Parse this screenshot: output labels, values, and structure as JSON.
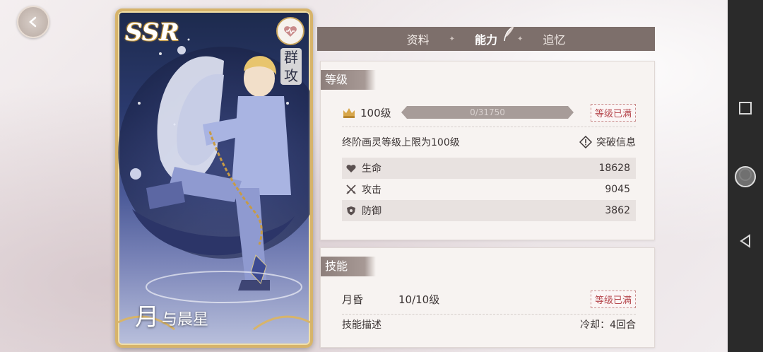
{
  "card": {
    "rarity": "SSR",
    "role": "群攻",
    "name_first": "月",
    "name_rest": "与晨星"
  },
  "tabs": [
    {
      "label": "资料"
    },
    {
      "label": "能力"
    },
    {
      "label": "追忆"
    }
  ],
  "level_section": {
    "title": "等级",
    "level": "100级",
    "xp_text": "0/31750",
    "xp_fraction": 0,
    "max_label": "等级已满",
    "limit_text": "终阶画灵等级上限为100级",
    "breakthrough_label": "突破信息",
    "stats": [
      {
        "label": "生命",
        "value": "18628",
        "icon": "heart-icon"
      },
      {
        "label": "攻击",
        "value": "9045",
        "icon": "crossed-swords-icon"
      },
      {
        "label": "防御",
        "value": "3862",
        "icon": "shield-icon"
      }
    ]
  },
  "skill_section": {
    "title": "技能",
    "skill_name": "月昏",
    "skill_level": "10/10级",
    "max_label": "等级已满",
    "desc_label": "技能描述",
    "cooldown": "冷却：4回合"
  },
  "colors": {
    "accent_gold": "#d7b46a",
    "panel_bg": "#f7f3f1",
    "tab_bar": "#7d6f6b",
    "max_badge": "#b6484e"
  }
}
